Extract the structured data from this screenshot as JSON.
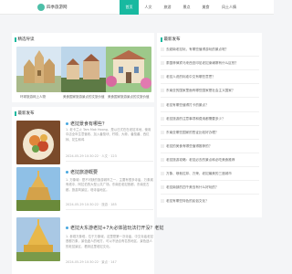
{
  "header": {
    "logo_text": "四季旅游网",
    "nav": [
      "首页",
      "人文",
      "旅游",
      "景点",
      "美食",
      "风土人情"
    ]
  },
  "featured": {
    "title": "精选导读",
    "items": [
      {
        "caption": "环球旅游网上人物"
      },
      {
        "caption": "美食国家旅游景点的文旅价值"
      },
      {
        "caption": "美食国家旅游景点的文旅价值"
      }
    ]
  },
  "latest": {
    "title": "最新发布",
    "articles": [
      {
        "title": "老挝景食有哪些？",
        "summary": "1. 老卡兰火 Tam Mak Hoong，是以日式在在老挝本地，使用中店全年生意营收、加入番茄块、柠檬、大蒜、番茄酱、西红柿、花生和鸡",
        "meta": "2024-05-29 10:30:22 · 人文 · 123"
      },
      {
        "title": "老挝旅游概要",
        "summary": "1. 万象城：是不可缺的旅游城市之一，主要有很多寺庙，万象城有塔中，阿拉伯的大型公共广场。东南亚老挝首都，东南亚古都，旅游风景区，塔寺庙地区。",
        "meta": "2024-05-29 10:30:22 · 旅游 · 185"
      },
      {
        "title": "老挝大东游老挝+7大必体验玩法打开没？老挝",
        "summary": "1. 参观万象塔，位于万象城，这里是第一次寺庙，中文寺庙老挝首都万象，景色迷人的地方，可以不适合有名的地区，景色迷人的老挝景区，看到这里老挝文化。",
        "meta": "2024-05-29 10:30:22 · 景点 · 147"
      }
    ]
  },
  "sidebar": {
    "title": "最新发布",
    "items": [
      "去越南老挝玩，有哪些值得游玩的景点呢？",
      "泰国菲律宾马来西亚印尼老挝柬埔寨有什么区别？",
      "老挝人说的标准中文有哪些意思？",
      "东南亚的国家里面有哪些国家是社会主义国家？",
      "老挝有哪些值得打卡的景点？",
      "老挝旅游的注意事项和费用都需要多少？",
      "东南亚哪些国家的签证比较好办理？",
      "老挝的美食有哪些值得推荐的？",
      "老挝旅游攻略：老挝必去的景点和必吃美食推荐",
      "万象、琅勃拉邦、万荣，老挝最美的三座城市",
      "老挝南部的四千美岛有什么好玩的？",
      "老挝有哪些特色的民俗文化？"
    ]
  },
  "colors": {
    "accent": "#18b9a0",
    "dot": "#4aa8e0"
  }
}
